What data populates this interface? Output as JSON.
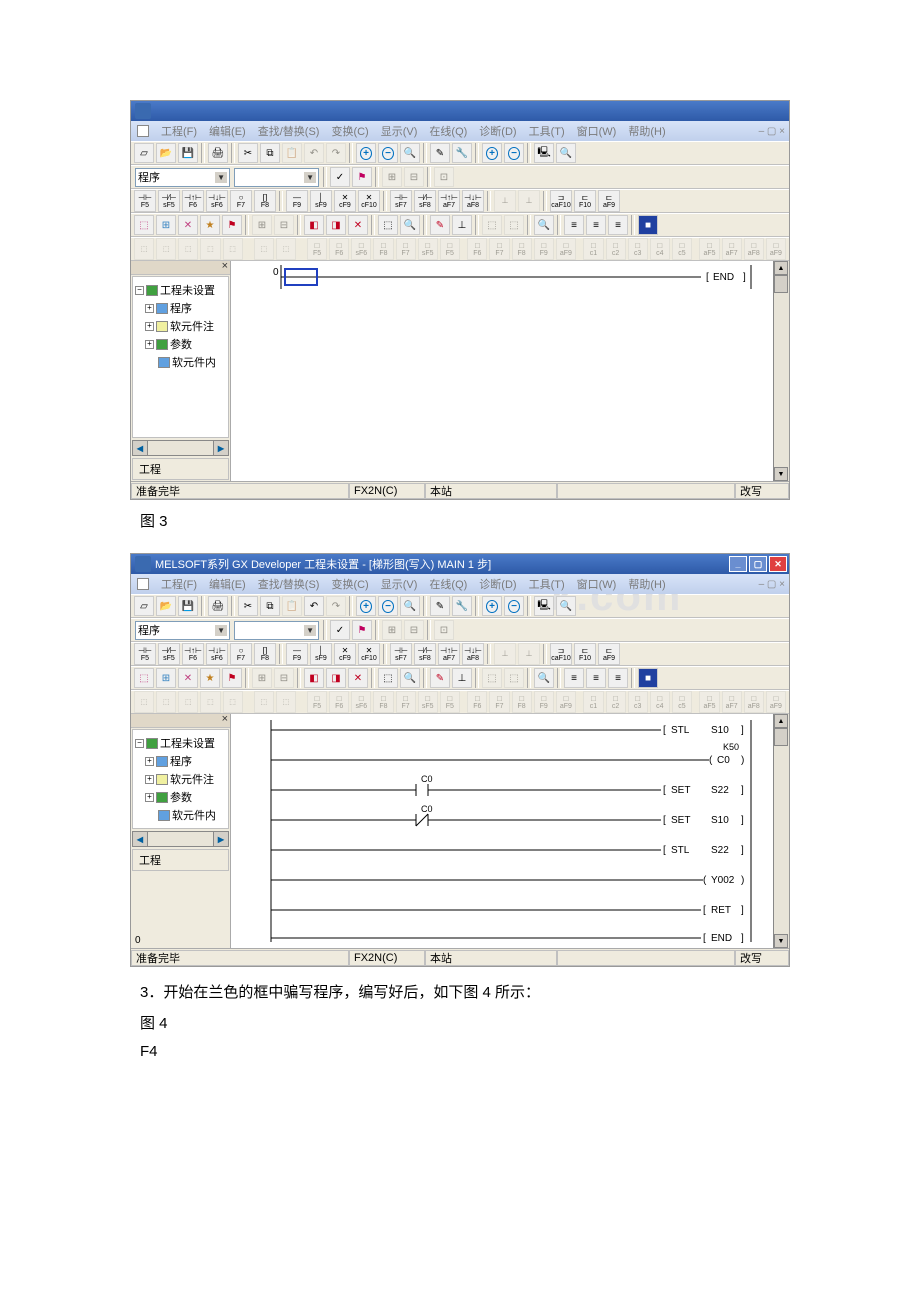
{
  "figure3": {
    "label": "图 3",
    "title_trunc": "",
    "menus": [
      "工程(F)",
      "编辑(E)",
      "查找/替换(S)",
      "变换(C)",
      "显示(V)",
      "在线(Q)",
      "诊断(D)",
      "工具(T)",
      "窗口(W)",
      "帮助(H)"
    ],
    "program_select": "程序",
    "fkey_rows": {
      "row2": [
        "F5",
        "sF5",
        "F6",
        "sF6",
        "F7",
        "F8",
        "",
        "F9",
        "sF9",
        "cF9",
        "cF10",
        "",
        "sF7",
        "sF8",
        "aF7",
        "aF8",
        "",
        "",
        "",
        "caF10",
        "F10",
        "aF9"
      ],
      "row4": [
        "F5",
        "F6",
        "sF6",
        "F8",
        "F7",
        "sF5",
        "F5",
        "",
        "F6",
        "F7",
        "F8",
        "F9",
        "aF9",
        "",
        "c1",
        "c2",
        "c3",
        "c4",
        "c5",
        "",
        "aF5",
        "aF7",
        "aF8",
        "aF9"
      ]
    },
    "tree": {
      "root": "工程未设置",
      "items": [
        "程序",
        "软元件注",
        "参数",
        "软元件内"
      ]
    },
    "project_label": "工程",
    "ladder": {
      "step": "0",
      "end": "END"
    },
    "status": {
      "ready": "准备完毕",
      "cpu": "FX2N(C)",
      "station": "本站",
      "mode": "改写"
    }
  },
  "narrative3": "3．开始在兰色的框中骗写程序，编写好后，如下图 4 所示：",
  "figure4": {
    "label": "图 4",
    "f4_label": "F4",
    "title": "MELSOFT系列 GX Developer 工程未设置 - [梯形图(写入)    MAIN    1 步]",
    "watermark": "k.com",
    "menus": [
      "工程(F)",
      "编辑(E)",
      "查找/替换(S)",
      "变换(C)",
      "显示(V)",
      "在线(Q)",
      "诊断(D)",
      "工具(T)",
      "窗口(W)",
      "帮助(H)"
    ],
    "program_select": "程序",
    "tree": {
      "root": "工程未设置",
      "items": [
        "程序",
        "软元件注",
        "参数",
        "软元件内"
      ]
    },
    "project_label": "工程",
    "ladder_rows": [
      {
        "instr": "STL",
        "op": "S10"
      },
      {
        "k": "K50",
        "coil": "C0"
      },
      {
        "contact": "C0",
        "open": true,
        "instr": "SET",
        "op": "S22"
      },
      {
        "contact": "C0",
        "open": false,
        "instr": "SET",
        "op": "S10"
      },
      {
        "instr": "STL",
        "op": "S22"
      },
      {
        "coil": "Y002"
      },
      {
        "instr": "RET"
      },
      {
        "instr": "END"
      }
    ],
    "step_zero": "0",
    "status": {
      "ready": "准备完毕",
      "cpu": "FX2N(C)",
      "station": "本站",
      "mode": "改写"
    }
  }
}
